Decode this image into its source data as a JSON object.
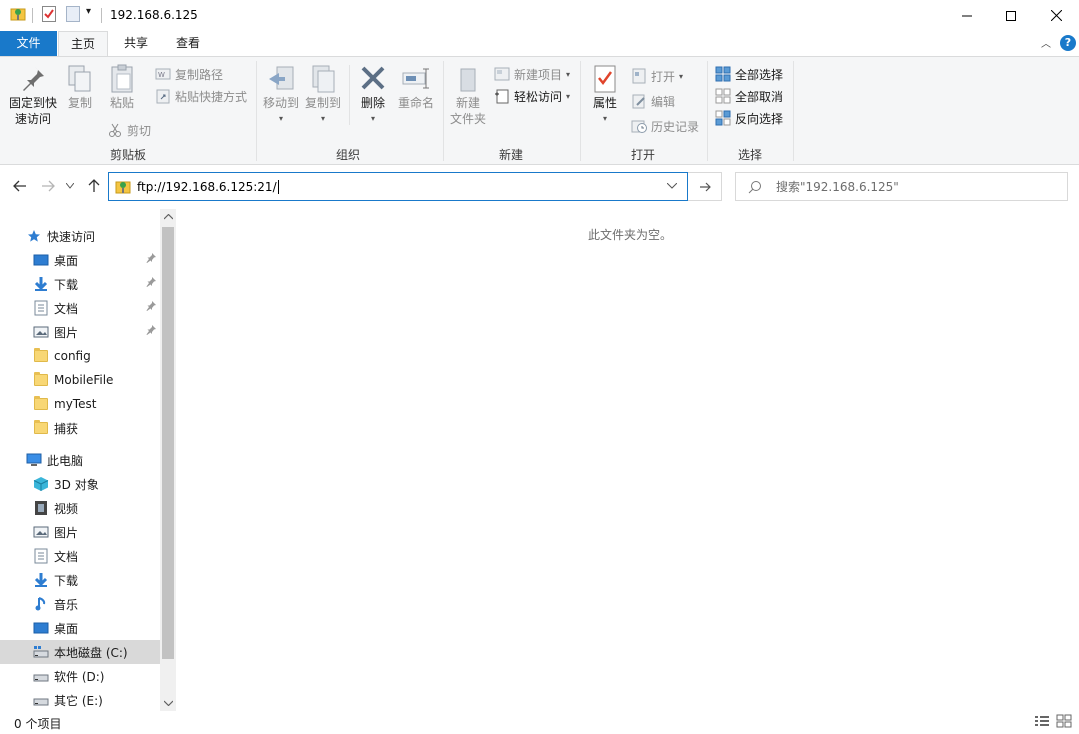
{
  "window": {
    "title": "192.168.6.125",
    "minimize_label": "—",
    "maximize_label": "☐",
    "close_label": "✕"
  },
  "tabs": {
    "file": "文件",
    "home": "主页",
    "share": "共享",
    "view": "查看"
  },
  "ribbon": {
    "clipboard": {
      "group": "剪贴板",
      "pin_line1": "固定到快",
      "pin_line2": "速访问",
      "copy": "复制",
      "paste": "粘贴",
      "copy_path": "复制路径",
      "paste_shortcut": "粘贴快捷方式",
      "cut": "剪切"
    },
    "organize": {
      "group": "组织",
      "move_to": "移动到",
      "copy_to": "复制到",
      "delete": "删除",
      "rename": "重命名"
    },
    "new": {
      "group": "新建",
      "new_folder_line1": "新建",
      "new_folder_line2": "文件夹",
      "new_item": "新建项目",
      "easy_access": "轻松访问"
    },
    "open": {
      "group": "打开",
      "properties": "属性",
      "open": "打开",
      "edit": "编辑",
      "history": "历史记录"
    },
    "select": {
      "group": "选择",
      "select_all": "全部选择",
      "select_none": "全部取消",
      "invert": "反向选择"
    }
  },
  "address": {
    "path": "ftp://192.168.6.125:21/",
    "search_placeholder": "搜索\"192.168.6.125\""
  },
  "nav": {
    "quick_access": "快速访问",
    "quick_items": [
      {
        "label": "桌面",
        "pinned": true
      },
      {
        "label": "下载",
        "pinned": true
      },
      {
        "label": "文档",
        "pinned": true
      },
      {
        "label": "图片",
        "pinned": true
      },
      {
        "label": "config",
        "pinned": false
      },
      {
        "label": "MobileFile",
        "pinned": false
      },
      {
        "label": "myTest",
        "pinned": false
      },
      {
        "label": "捕获",
        "pinned": false
      }
    ],
    "this_pc": "此电脑",
    "pc_items": [
      {
        "label": "3D 对象"
      },
      {
        "label": "视频"
      },
      {
        "label": "图片"
      },
      {
        "label": "文档"
      },
      {
        "label": "下载"
      },
      {
        "label": "音乐"
      },
      {
        "label": "桌面"
      },
      {
        "label": "本地磁盘 (C:)"
      },
      {
        "label": "软件 (D:)"
      },
      {
        "label": "其它 (E:)"
      }
    ]
  },
  "content": {
    "empty_message": "此文件夹为空。"
  },
  "status": {
    "item_count": "0 个项目"
  },
  "colors": {
    "accent": "#1979ca",
    "ribbon_bg": "#f5f6f7",
    "selected_nav": "#d9d9d9"
  }
}
